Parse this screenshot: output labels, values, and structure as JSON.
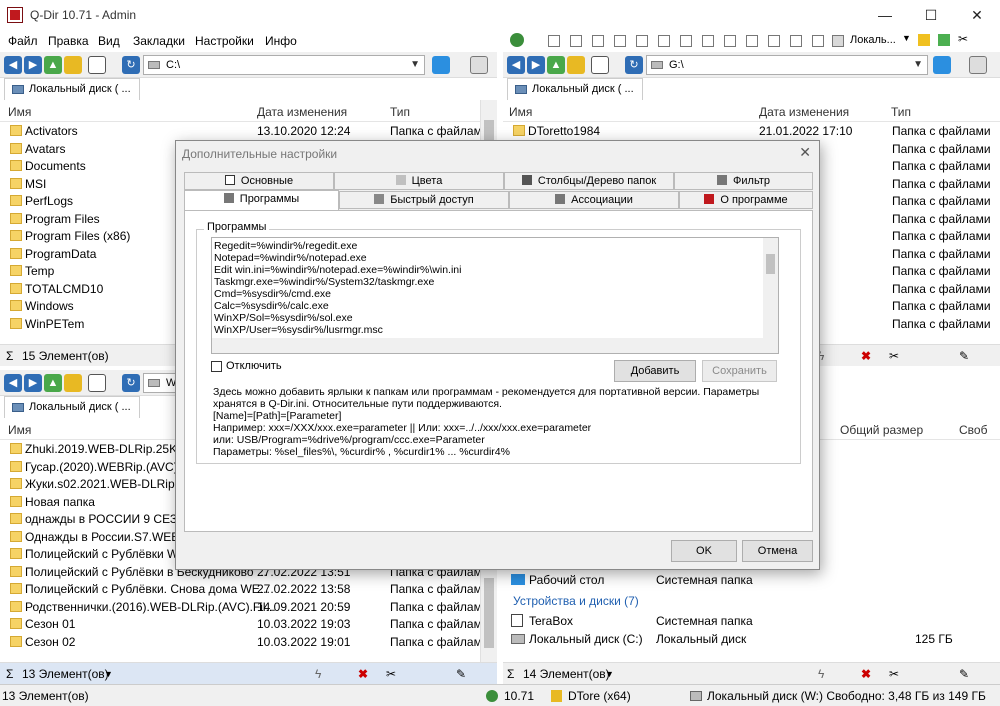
{
  "window": {
    "title": "Q-Dir 10.71 - Admin",
    "min": "—",
    "max": "☐",
    "close": "✕"
  },
  "menu": [
    "Файл",
    "Правка",
    "Вид",
    "Закладки",
    "Настройки",
    "Инфо"
  ],
  "top_right_toolbar": {
    "location_label": "Локаль..."
  },
  "panels": {
    "top_left": {
      "path": "C:\\",
      "tab": "Локальный диск ( ...",
      "columns": [
        "Имя",
        "Дата изменения",
        "Тип"
      ],
      "rows": [
        {
          "name": "Activators",
          "date": "13.10.2020 12:24",
          "type": "Папка с файлами"
        },
        {
          "name": "Avatars",
          "date": "",
          "type": ""
        },
        {
          "name": "Documents",
          "date": "",
          "type": ""
        },
        {
          "name": "MSI",
          "date": "",
          "type": ""
        },
        {
          "name": "PerfLogs",
          "date": "",
          "type": ""
        },
        {
          "name": "Program Files",
          "date": "",
          "type": ""
        },
        {
          "name": "Program Files (x86)",
          "date": "",
          "type": ""
        },
        {
          "name": "ProgramData",
          "date": "",
          "type": ""
        },
        {
          "name": "Temp",
          "date": "",
          "type": ""
        },
        {
          "name": "TOTALCMD10",
          "date": "",
          "type": ""
        },
        {
          "name": "Windows",
          "date": "",
          "type": ""
        },
        {
          "name": "WinPETem",
          "date": "",
          "type": ""
        }
      ],
      "status": "15 Элемент(ов)"
    },
    "top_right": {
      "path": "G:\\",
      "tab": "Локальный диск ( ...",
      "columns": [
        "Имя",
        "Дата изменения",
        "Тип"
      ],
      "rows": [
        {
          "name": "DToretto1984",
          "date": "21.01.2022 17:10",
          "type": "Папка с файлами"
        },
        {
          "name": "",
          "date": "2:31",
          "type": "Папка с файлами"
        },
        {
          "name": "",
          "date": "7:14",
          "type": "Папка с файлами"
        },
        {
          "name": "",
          "date": "0:10",
          "type": "Папка с файлами"
        },
        {
          "name": "",
          "date": "2:26",
          "type": "Папка с файлами"
        },
        {
          "name": "",
          "date": "1:53",
          "type": "Папка с файлами"
        },
        {
          "name": "",
          "date": "2:38",
          "type": "Папка с файлами"
        },
        {
          "name": "",
          "date": "0:40",
          "type": "Папка с файлами"
        },
        {
          "name": "",
          "date": "1:29",
          "type": "Папка с файлами"
        },
        {
          "name": "",
          "date": "5:00",
          "type": "Папка с файлами"
        },
        {
          "name": "",
          "date": "4:08",
          "type": "Папка с файлами"
        },
        {
          "name": "",
          "date": "0:47",
          "type": "Папка с файлами"
        }
      ]
    },
    "bottom_left": {
      "path": "W:\\",
      "tab": "Локальный диск ( ...",
      "columns": [
        "Имя"
      ],
      "rows": [
        {
          "name": "Zhuki.2019.WEB-DLRip.25Kuzm",
          "date": "",
          "type": ""
        },
        {
          "name": "Гусар.(2020).WEBRip.(AVC).Files",
          "date": "",
          "type": ""
        },
        {
          "name": "Жуки.s02.2021.WEB-DLRip.Files",
          "date": "",
          "type": ""
        },
        {
          "name": "Новая папка",
          "date": "",
          "type": ""
        },
        {
          "name": "однажды в РОССИИ 9 СЕЗОН",
          "date": "",
          "type": ""
        },
        {
          "name": "Однажды в России.S7.WEB-DL",
          "date": "",
          "type": ""
        },
        {
          "name": "Полицейский с Рублёвки WEB",
          "date": "",
          "type": ""
        },
        {
          "name": "Полицейский с Рублёвки в Бескудниково ...",
          "date": "27.02.2022 13:51",
          "type": "Папка с файлами"
        },
        {
          "name": "Полицейский с Рублёвки. Снова дома WE...",
          "date": "27.02.2022 13:58",
          "type": "Папка с файлами"
        },
        {
          "name": "Родственнички.(2016).WEB-DLRip.(AVC).Fil...",
          "date": "14.09.2021 20:59",
          "type": "Папка с файлами"
        },
        {
          "name": "Сезон 01",
          "date": "10.03.2022 19:03",
          "type": "Папка с файлами"
        },
        {
          "name": "Сезон 02",
          "date": "10.03.2022 19:01",
          "type": "Папка с файлами"
        }
      ],
      "status": "13 Элемент(ов)"
    },
    "bottom_right": {
      "columns": [
        "Общий размер",
        "Своб"
      ],
      "rows": [
        {
          "name": "Рабочий стол",
          "type": "Системная папка",
          "size": ""
        },
        {
          "name": "Устройства и диски (7)",
          "type": "",
          "size": ""
        },
        {
          "name": "TeraBox",
          "type": "Системная папка",
          "size": ""
        },
        {
          "name": "Локальный диск (C:)",
          "type": "Локальный диск",
          "size": "125 ГБ"
        }
      ],
      "status": "14 Элемент(ов)"
    }
  },
  "dialog": {
    "title": "Дополнительные настройки",
    "tabs_row1": [
      "Основные",
      "Цвета",
      "Столбцы/Дерево папок",
      "Фильтр"
    ],
    "tabs_row2": [
      "Программы",
      "Быстрый доступ",
      "Ассоциации",
      "О программе"
    ],
    "group_label": "Программы",
    "program_lines": [
      "Regedit=%windir%/regedit.exe",
      "Notepad=%windir%/notepad.exe",
      "Edit win.ini=%windir%/notepad.exe=%windir%\\win.ini",
      "Taskmgr.exe=%windir%/System32/taskmgr.exe",
      "Cmd=%sysdir%/cmd.exe",
      "Calc=%sysdir%/calc.exe",
      "WinXP/Sol=%sysdir%/sol.exe",
      "WinXP/User=%sysdir%/lusrmgr.msc"
    ],
    "disable_label": "Отключить",
    "add_button": "Добавить",
    "save_button": "Сохранить",
    "description": [
      "Здесь можно добавить ярлыки к папкам или программам - рекомендуется для портативной версии. Параметры",
      "хранятся в Q-Dir.ini. Относительные пути поддерживаются.",
      "[Name]=[Path]=[Parameter]",
      "Например: xxx=/XXX/xxx.exe=parameter || Или: xxx=../../xxx/xxx.exe=parameter",
      " или: USB/Program=%drive%/program/ccc.exe=Parameter",
      " Параметры: %sel_files%\\, %curdir% , %curdir1% ... %curdir4%"
    ],
    "ok_button": "OK",
    "cancel_button": "Отмена"
  },
  "bottom_status": {
    "left": "13 Элемент(ов)",
    "version": "10.71",
    "user": "DTore (x64)",
    "disk": "Локальный диск (W:) Свободно: 3,48 ГБ из 149 ГБ"
  }
}
